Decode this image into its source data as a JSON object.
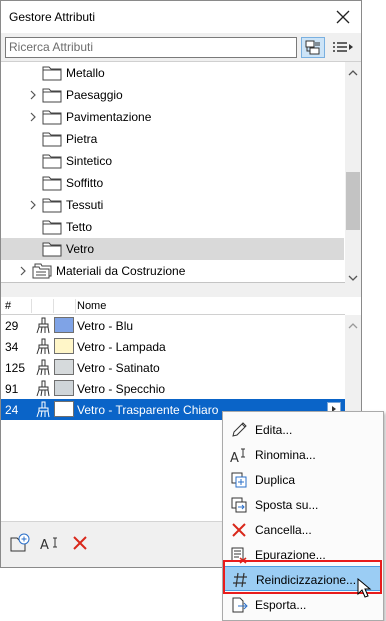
{
  "window": {
    "title": "Gestore Attributi",
    "close_glyph": "✕"
  },
  "search": {
    "placeholder": "Ricerca Attributi",
    "value": ""
  },
  "tree": {
    "items": [
      {
        "label": "Metallo",
        "expandable": false,
        "selected": false
      },
      {
        "label": "Paesaggio",
        "expandable": true,
        "selected": false
      },
      {
        "label": "Pavimentazione",
        "expandable": true,
        "selected": false
      },
      {
        "label": "Pietra",
        "expandable": false,
        "selected": false
      },
      {
        "label": "Sintetico",
        "expandable": false,
        "selected": false
      },
      {
        "label": "Soffitto",
        "expandable": false,
        "selected": false
      },
      {
        "label": "Tessuti",
        "expandable": true,
        "selected": false
      },
      {
        "label": "Tetto",
        "expandable": false,
        "selected": false
      },
      {
        "label": "Vetro",
        "expandable": false,
        "selected": true
      },
      {
        "label": "Materiali da Costruzione",
        "expandable": true,
        "selected": false
      }
    ]
  },
  "list": {
    "columns": {
      "num": "#",
      "name": "Nome"
    },
    "rows": [
      {
        "num": "29",
        "name": "Vetro - Blu",
        "color": "#7fa3e6",
        "selected": false
      },
      {
        "num": "34",
        "name": "Vetro - Lampada",
        "color": "#fff6c8",
        "selected": false
      },
      {
        "num": "125",
        "name": "Vetro - Satinato",
        "color": "#d6dadc",
        "selected": false
      },
      {
        "num": "91",
        "name": "Vetro - Specchio",
        "color": "#cfd5d9",
        "selected": false
      },
      {
        "num": "24",
        "name": "Vetro - Trasparente Chiaro",
        "color": "#ffffff",
        "selected": true
      }
    ]
  },
  "context_menu": {
    "items": [
      {
        "label": "Edita...",
        "icon": "pencil-icon"
      },
      {
        "label": "Rinomina...",
        "icon": "rename-icon"
      },
      {
        "label": "Duplica",
        "icon": "duplicate-icon"
      },
      {
        "label": "Sposta su...",
        "icon": "move-icon"
      },
      {
        "label": "Cancella...",
        "icon": "delete-x-icon"
      },
      {
        "label": "Epurazione...",
        "icon": "purge-icon"
      },
      {
        "label": "Reindicizzazione...",
        "icon": "hash-icon",
        "highlighted": true
      },
      {
        "label": "Esporta...",
        "icon": "export-icon"
      }
    ]
  },
  "colors": {
    "selection": "#0a64c8",
    "menu_highlight": "#9bcdf4",
    "red_accent": "#e81c1c"
  }
}
